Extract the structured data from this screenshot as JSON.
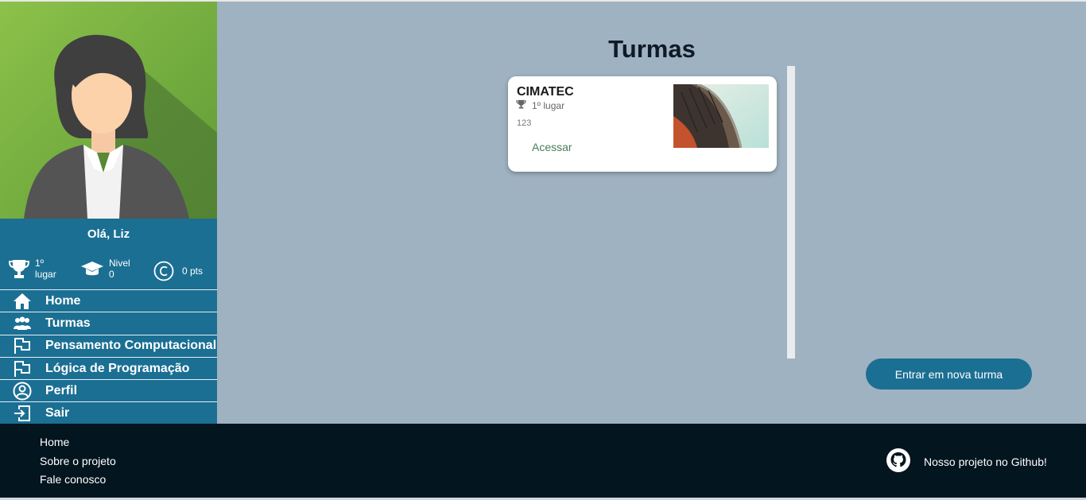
{
  "sidebar": {
    "greeting": "Olá, Liz",
    "stats": {
      "rank_line1": "1º",
      "rank_line2": "lugar",
      "level_line1": "Nivel",
      "level_line2": "0",
      "points": "0 pts"
    },
    "menu": [
      {
        "label": "Home",
        "icon": "home-icon"
      },
      {
        "label": "Turmas",
        "icon": "users-icon"
      },
      {
        "label": "Pensamento Computacional",
        "icon": "flag-icon"
      },
      {
        "label": "Lógica de Programação",
        "icon": "flag-icon"
      },
      {
        "label": "Perfil",
        "icon": "user-circle-icon"
      },
      {
        "label": "Sair",
        "icon": "logout-icon"
      }
    ]
  },
  "main": {
    "title": "Turmas",
    "card": {
      "name": "CIMATEC",
      "rank": "1º lugar",
      "code": "123",
      "action": "Acessar"
    },
    "join_button": "Entrar em nova turma"
  },
  "footer": {
    "links": [
      "Home",
      "Sobre o projeto",
      "Fale conosco"
    ],
    "github": "Nosso projeto no Github!"
  },
  "colors": {
    "sidebar": "#1b6f93",
    "main_bg": "#9fb2c1",
    "footer": "#03151f",
    "accent_green": "#4a7d55"
  }
}
